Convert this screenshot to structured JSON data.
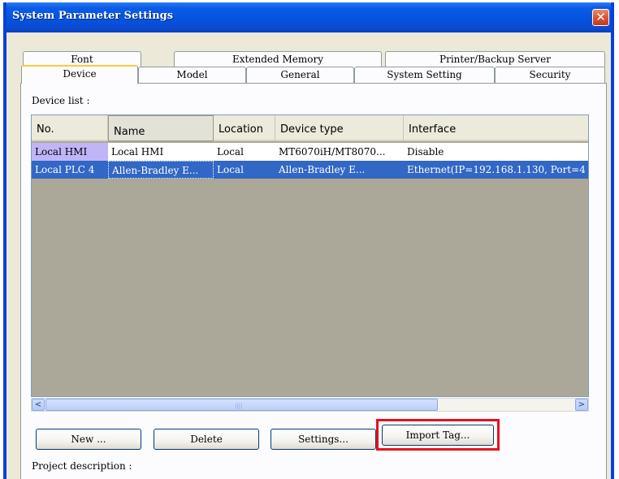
{
  "window": {
    "title": "System Parameter Settings",
    "close_glyph": "✕"
  },
  "tabs": {
    "row1": [
      {
        "label": "Font"
      },
      {
        "label": "Extended Memory"
      },
      {
        "label": "Printer/Backup Server"
      }
    ],
    "row2": [
      {
        "label": "Device",
        "active": true
      },
      {
        "label": "Model"
      },
      {
        "label": "General"
      },
      {
        "label": "System Setting"
      },
      {
        "label": "Security"
      }
    ]
  },
  "device_list": {
    "label": "Device list :",
    "columns": [
      "No.",
      "Name",
      "Location",
      "Device type",
      "Interface"
    ],
    "rows": [
      {
        "no": "Local HMI",
        "name": "Local HMI",
        "location": "Local",
        "device_type": "MT6070iH/MT8070...",
        "interface": "Disable"
      },
      {
        "no": "Local PLC 4",
        "name": "Allen-Bradley E...",
        "location": "Local",
        "device_type": "Allen-Bradley E...",
        "interface": "Ethernet(IP=192.168.1.130, Port=4"
      }
    ]
  },
  "scrollbar": {
    "left_arrow": "<",
    "right_arrow": ">",
    "grip": "||||"
  },
  "buttons": {
    "new": "New ...",
    "delete": "Delete",
    "settings": "Settings...",
    "import_tag": "Import Tag..."
  },
  "project_description_label": "Project description :",
  "colors": {
    "title_bar": "#0553df",
    "highlight": "#e8101e",
    "selection": "#3167c5"
  }
}
